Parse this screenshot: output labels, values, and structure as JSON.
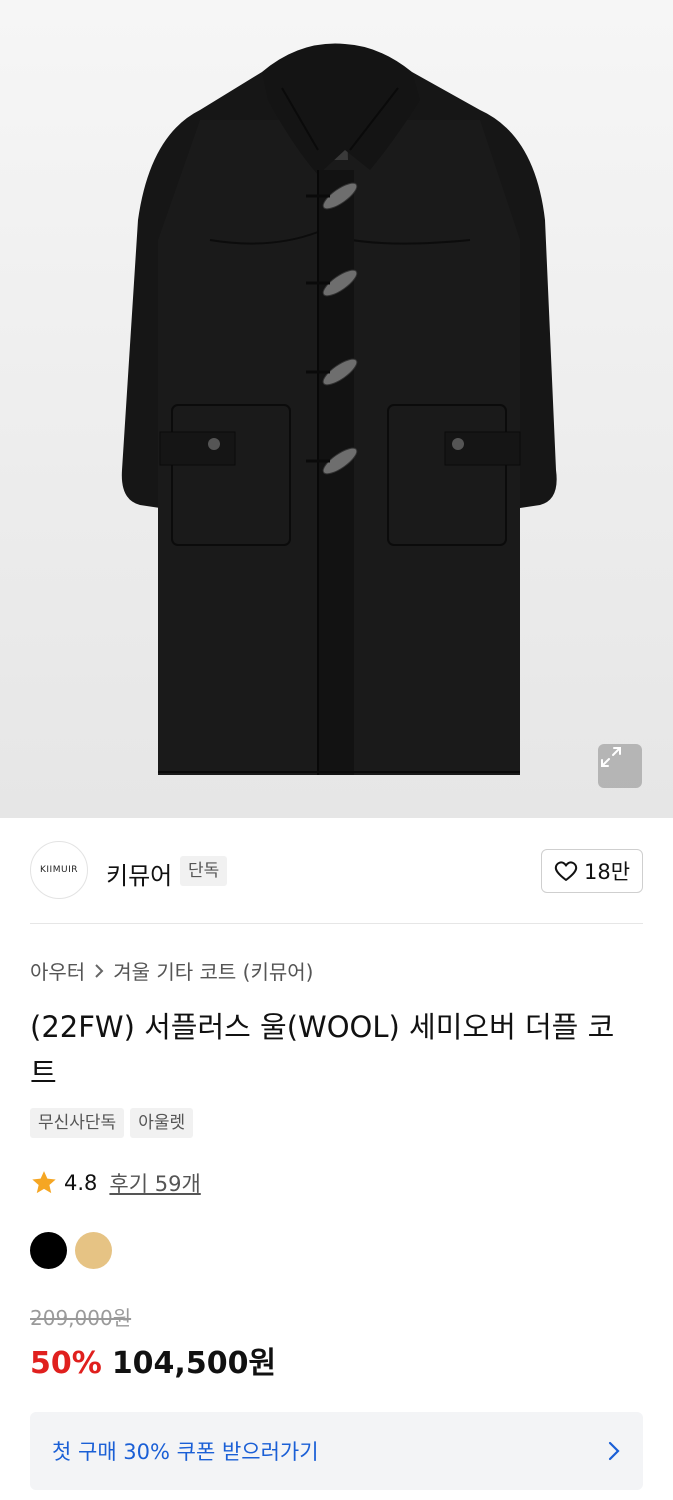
{
  "product_image": {
    "alt": "(22FW) 서플러스 울(WOOL) 세미오버 더플 코트",
    "expand_icon": "expand-arrows-icon"
  },
  "brand": {
    "logo_text": "KIIMUIR",
    "name": "키뮤어",
    "badge": "단독",
    "like_icon": "heart-outline-icon",
    "like_count": "18만"
  },
  "breadcrumb": {
    "items": [
      "아우터",
      "겨울 기타 코트 (키뮤어)"
    ],
    "separator_icon": "chevron-right-icon"
  },
  "product": {
    "title": "(22FW) 서플러스 울(WOOL) 세미오버 더플 코트",
    "tags": [
      "무신사단독",
      "아울렛"
    ]
  },
  "rating": {
    "star_icon": "star-filled-icon",
    "score": "4.8",
    "reviews_label": "후기 59개",
    "star_color": "#f5a623"
  },
  "colors": {
    "swatches": [
      {
        "name": "black",
        "hex": "#000000"
      },
      {
        "name": "beige",
        "hex": "#e6c384"
      }
    ]
  },
  "price": {
    "original": "209,000원",
    "discount": "50%",
    "sale": "104,500원",
    "discount_color": "#e0201e"
  },
  "coupon": {
    "text": "첫 구매 30% 쿠폰 받으러가기",
    "arrow_icon": "chevron-right-icon",
    "text_color": "#1a5fd6"
  }
}
